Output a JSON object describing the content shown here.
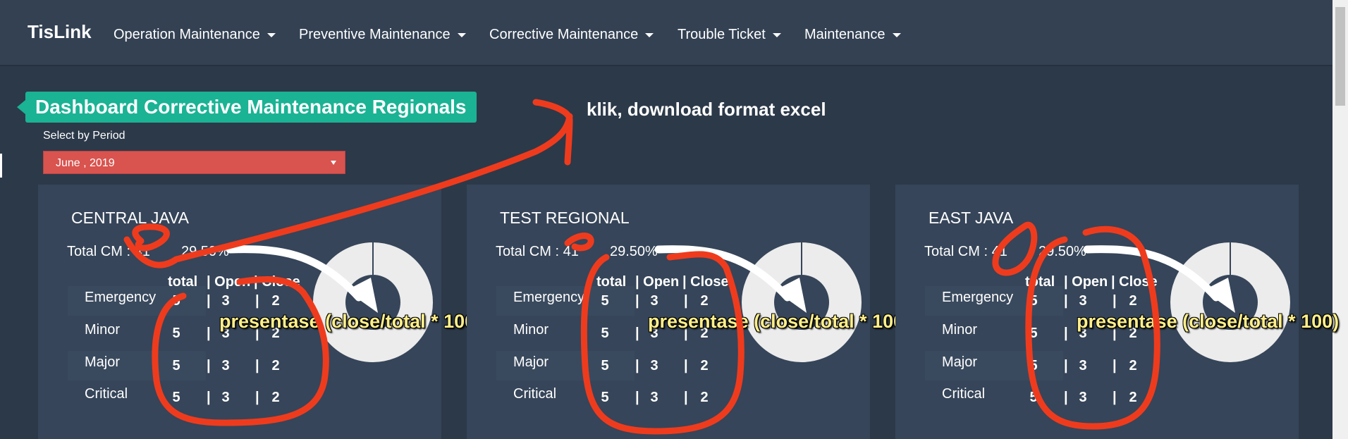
{
  "navbar": {
    "brand": "TisLink",
    "items": [
      {
        "label": "Operation Maintenance"
      },
      {
        "label": "Preventive Maintenance"
      },
      {
        "label": "Corrective Maintenance"
      },
      {
        "label": "Trouble Ticket"
      },
      {
        "label": "Maintenance"
      }
    ]
  },
  "page": {
    "title": "Dashboard Corrective Maintenance Regionals",
    "period_label": "Select by Period",
    "period_value": "June , 2019"
  },
  "annotations": {
    "download_note": "klik, download format excel",
    "formula_note": "presentase (close/total * 100)"
  },
  "table_headers": {
    "total": "total",
    "open": "| Open",
    "close": "| Close"
  },
  "cards": [
    {
      "title": "CENTRAL JAVA",
      "total_label": "Total CM : 41",
      "percentage": "29.50%",
      "rows": [
        {
          "label": "Emergency",
          "total": "5",
          "open": "3",
          "close": "2"
        },
        {
          "label": "Minor",
          "total": "5",
          "open": "3",
          "close": "2"
        },
        {
          "label": "Major",
          "total": "5",
          "open": "3",
          "close": "2"
        },
        {
          "label": "Critical",
          "total": "5",
          "open": "3",
          "close": "2"
        }
      ]
    },
    {
      "title": "TEST REGIONAL",
      "total_label": "Total CM : 41",
      "percentage": "29.50%",
      "rows": [
        {
          "label": "Emergency",
          "total": "5",
          "open": "3",
          "close": "2"
        },
        {
          "label": "Minor",
          "total": "5",
          "open": "3",
          "close": "2"
        },
        {
          "label": "Major",
          "total": "5",
          "open": "3",
          "close": "2"
        },
        {
          "label": "Critical",
          "total": "5",
          "open": "3",
          "close": "2"
        }
      ]
    },
    {
      "title": "EAST JAVA",
      "total_label": "Total CM : 41",
      "percentage": "29.50%",
      "rows": [
        {
          "label": "Emergency",
          "total": "5",
          "open": "3",
          "close": "2"
        },
        {
          "label": "Minor",
          "total": "5",
          "open": "3",
          "close": "2"
        },
        {
          "label": "Major",
          "total": "5",
          "open": "3",
          "close": "2"
        },
        {
          "label": "Critical",
          "total": "5",
          "open": "3",
          "close": "2"
        }
      ]
    }
  ],
  "colors": {
    "background": "#2c3949",
    "navbar": "#334153",
    "card": "#364559",
    "title_badge": "#1ab394",
    "period_select": "#d9534f",
    "annotation_red": "#ef3b1d",
    "donut": "#ececec"
  }
}
